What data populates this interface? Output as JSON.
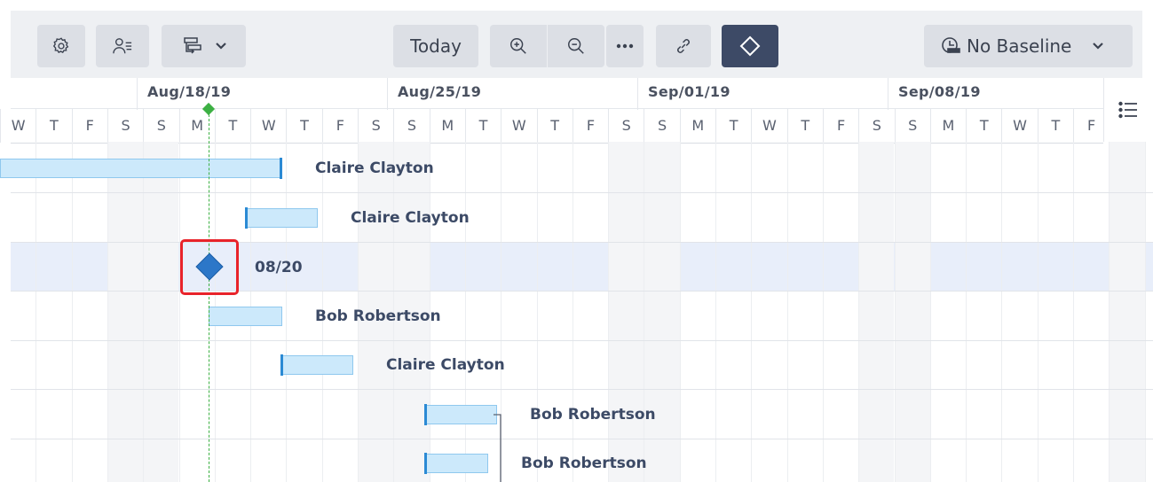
{
  "toolbar": {
    "today_label": "Today",
    "baseline_label": "No Baseline",
    "icons": [
      "gear-icon",
      "assign-people-icon",
      "task-hierarchy-icon",
      "chevron-down-icon",
      "zoom-in-icon",
      "zoom-out-icon",
      "more-icon",
      "link-icon",
      "milestone-icon",
      "baseline-icon",
      "chevron-down-icon"
    ],
    "active_color": "#3d4a66"
  },
  "timeline": {
    "weeks": [
      "Aug/18/19",
      "Aug/25/19",
      "Sep/01/19",
      "Sep/08/19"
    ],
    "days": [
      "W",
      "T",
      "F",
      "S",
      "S",
      "M",
      "T",
      "W",
      "T",
      "F",
      "S",
      "S",
      "M",
      "T",
      "W",
      "T",
      "F",
      "S",
      "S",
      "M",
      "T",
      "W",
      "T",
      "F",
      "S",
      "S",
      "M",
      "T",
      "W",
      "T",
      "F"
    ]
  },
  "rows": [
    {
      "label": "Claire Clayton",
      "type": "task"
    },
    {
      "label": "Claire Clayton",
      "type": "task"
    },
    {
      "label": "08/20",
      "type": "milestone",
      "selected": true
    },
    {
      "label": "Bob Robertson",
      "type": "task"
    },
    {
      "label": "Claire Clayton",
      "type": "task"
    },
    {
      "label": "Bob Robertson",
      "type": "task"
    },
    {
      "label": "Bob Robertson",
      "type": "task"
    }
  ],
  "colors": {
    "bar_fill": "#cce9fb",
    "bar_edge": "#2b8ad4",
    "milestone": "#2c77c8",
    "today_marker": "#3cb043",
    "highlight": "#e8232a",
    "selected_row": "#e8eefa"
  }
}
